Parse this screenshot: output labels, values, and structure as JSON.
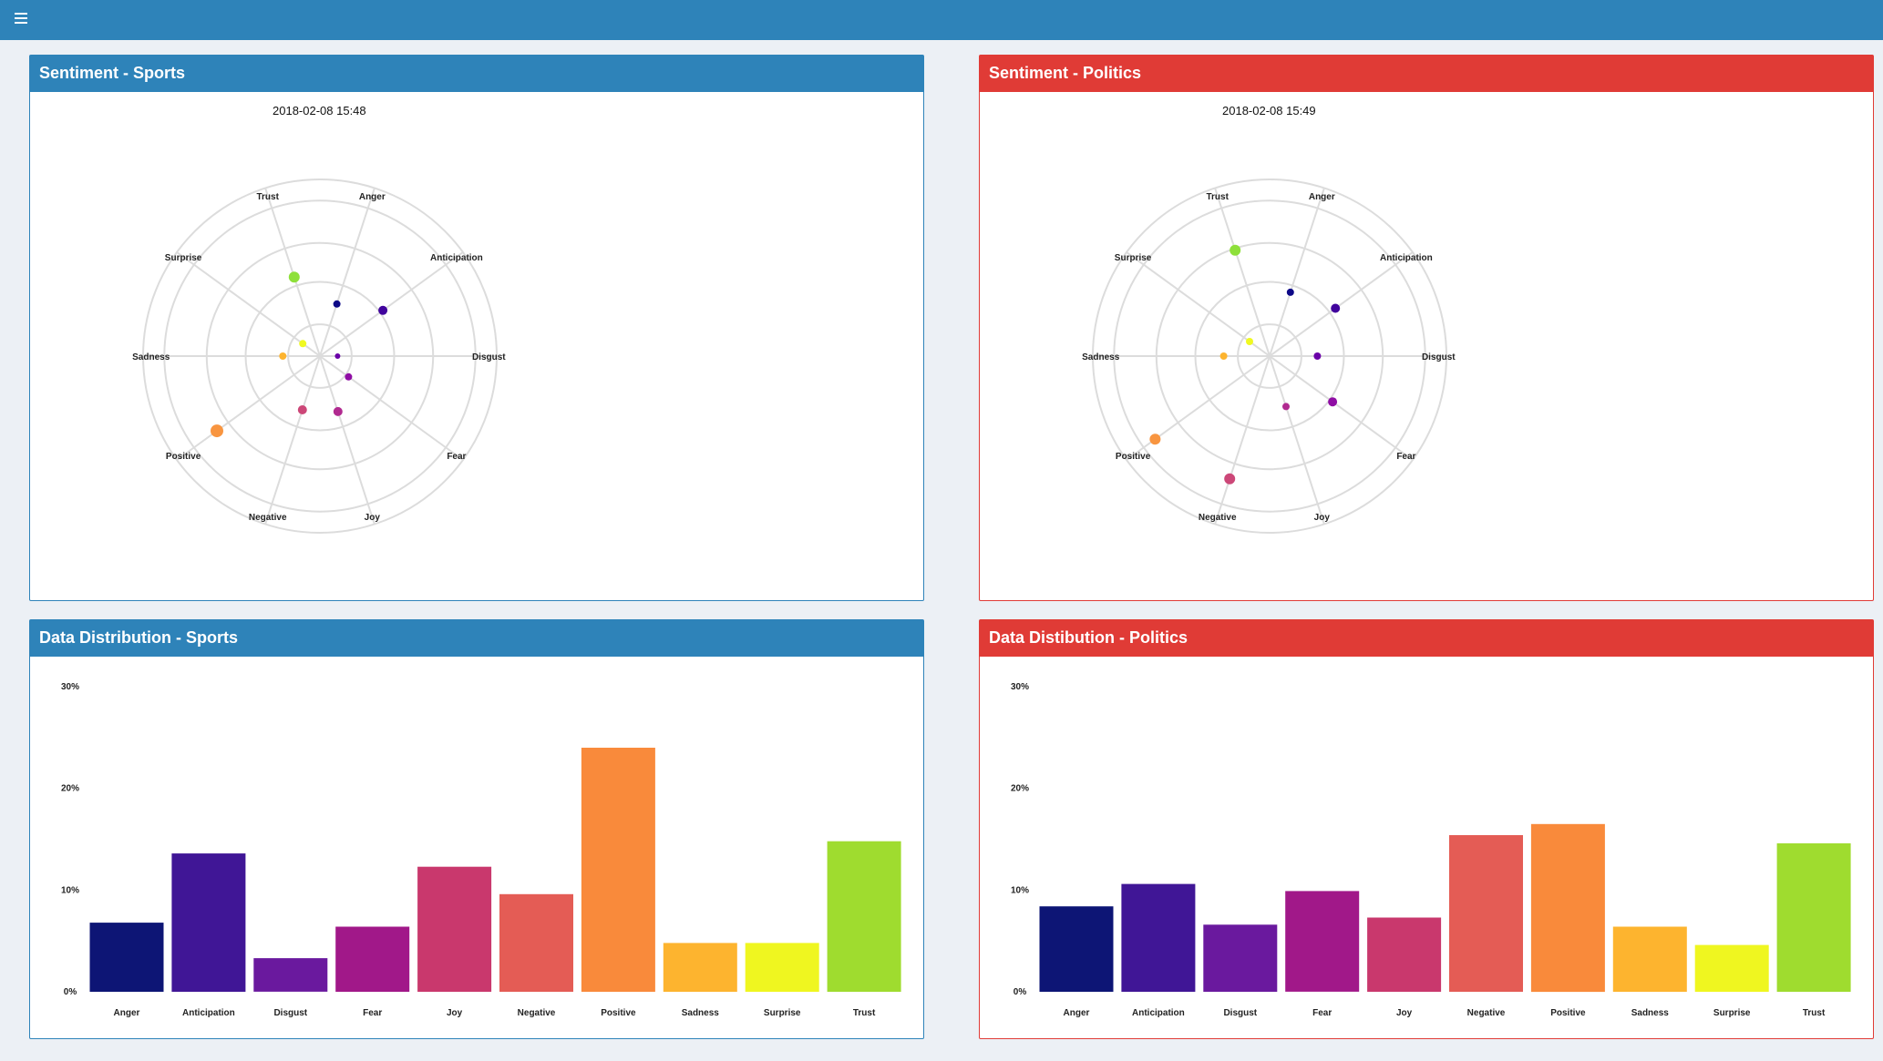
{
  "app": {
    "menu_icon": "hamburger-icon",
    "header_color": "#2e83b9"
  },
  "panels": {
    "sentiment_sports": {
      "title": "Sentiment - Sports",
      "timestamp": "2018-02-08 15:48",
      "color": "#2e83b9"
    },
    "sentiment_politics": {
      "title": "Sentiment - Politics",
      "timestamp": "2018-02-08 15:49",
      "color": "#e03b36"
    },
    "dist_sports": {
      "title": "Data Distribution - Sports",
      "color": "#2e83b9"
    },
    "dist_politics": {
      "title": "Data Distibution - Politics",
      "color": "#e03b36"
    }
  },
  "chart_data": [
    {
      "id": "radar-sports",
      "type": "scatter",
      "coordinate_system": "polar",
      "title": "Sentiment - Sports",
      "timestamp": "2018-02-08 15:48",
      "categories": [
        "Anger",
        "Anticipation",
        "Disgust",
        "Fear",
        "Joy",
        "Negative",
        "Positive",
        "Sadness",
        "Surprise",
        "Trust"
      ],
      "values": [
        0.31,
        0.44,
        0.1,
        0.2,
        0.33,
        0.32,
        0.72,
        0.21,
        0.12,
        0.47
      ],
      "colors": [
        "#0d0887",
        "#41049d",
        "#6a00a8",
        "#8f0da4",
        "#b12a90",
        "#cc4778",
        "#f89540",
        "#fdb42f",
        "#f0f921",
        "#8ee03a"
      ],
      "point_sizes": [
        4,
        5,
        3,
        4,
        5,
        5,
        7,
        4,
        4,
        6
      ],
      "radial_range": [
        0,
        1
      ],
      "grid": true,
      "rings": 5
    },
    {
      "id": "radar-politics",
      "type": "scatter",
      "coordinate_system": "polar",
      "title": "Sentiment - Politics",
      "timestamp": "2018-02-08 15:49",
      "categories": [
        "Anger",
        "Anticipation",
        "Disgust",
        "Fear",
        "Joy",
        "Negative",
        "Positive",
        "Sadness",
        "Surprise",
        "Trust"
      ],
      "values": [
        0.38,
        0.46,
        0.27,
        0.44,
        0.3,
        0.73,
        0.8,
        0.26,
        0.14,
        0.63
      ],
      "colors": [
        "#0d0887",
        "#41049d",
        "#6a00a8",
        "#8f0da4",
        "#b12a90",
        "#cc4778",
        "#f89540",
        "#fdb42f",
        "#f0f921",
        "#8ee03a"
      ],
      "point_sizes": [
        4,
        5,
        4,
        5,
        4,
        6,
        6,
        4,
        4,
        6
      ],
      "radial_range": [
        0,
        1
      ],
      "grid": true,
      "rings": 5
    },
    {
      "id": "bars-sports",
      "type": "bar",
      "title": "Data Distribution - Sports",
      "categories": [
        "Anger",
        "Anticipation",
        "Disgust",
        "Fear",
        "Joy",
        "Negative",
        "Positive",
        "Sadness",
        "Surprise",
        "Trust"
      ],
      "values": [
        6.8,
        13.6,
        3.3,
        6.4,
        12.3,
        9.6,
        24.0,
        4.8,
        4.8,
        14.8
      ],
      "colors": [
        "#0d1575",
        "#401696",
        "#6a199e",
        "#a11889",
        "#c9386d",
        "#e45c55",
        "#f98a3b",
        "#fdb42f",
        "#eff620",
        "#9fdc2f"
      ],
      "ylim": [
        0,
        30
      ],
      "yticks": [
        "0%",
        "10%",
        "20%",
        "30%"
      ],
      "grid": false
    },
    {
      "id": "bars-politics",
      "type": "bar",
      "title": "Data Distibution - Politics",
      "categories": [
        "Anger",
        "Anticipation",
        "Disgust",
        "Fear",
        "Joy",
        "Negative",
        "Positive",
        "Sadness",
        "Surprise",
        "Trust"
      ],
      "values": [
        8.4,
        10.6,
        6.6,
        9.9,
        7.3,
        15.4,
        16.5,
        6.4,
        4.6,
        14.6
      ],
      "colors": [
        "#0d1575",
        "#401696",
        "#6a199e",
        "#a11889",
        "#c9386d",
        "#e45c55",
        "#f98a3b",
        "#fdb42f",
        "#eff620",
        "#9fdc2f"
      ],
      "ylim": [
        0,
        30
      ],
      "yticks": [
        "0%",
        "10%",
        "20%",
        "30%"
      ],
      "grid": false
    }
  ]
}
